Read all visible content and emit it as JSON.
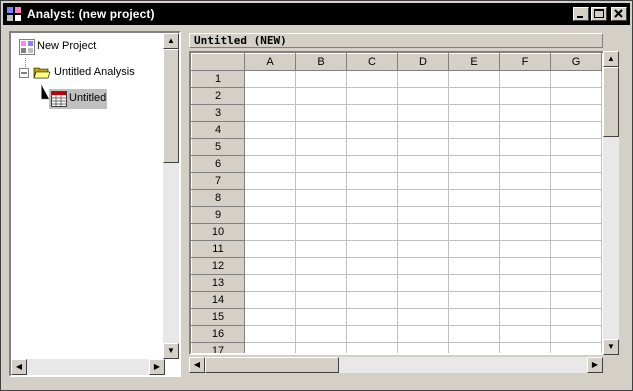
{
  "window": {
    "title": "Analyst: (new project)"
  },
  "tree": {
    "items": [
      {
        "label": "New Project",
        "icon": "project-icon"
      },
      {
        "label": "Untitled Analysis",
        "icon": "folder-open-icon",
        "expanded": true
      },
      {
        "label": "Untitled",
        "icon": "table-icon",
        "selected": true
      }
    ]
  },
  "table": {
    "title": "Untitled (NEW)",
    "columns": [
      "A",
      "B",
      "C",
      "D",
      "E",
      "F",
      "G"
    ],
    "rows": [
      "1",
      "2",
      "3",
      "4",
      "5",
      "6",
      "7",
      "8",
      "9",
      "10",
      "11",
      "12",
      "13",
      "14",
      "15",
      "16",
      "17"
    ]
  },
  "colors": {
    "titlebar": "#000000",
    "frame": "#d4d0c8",
    "grid_line": "#c0c0c0",
    "selection": "#c0c0c0"
  }
}
